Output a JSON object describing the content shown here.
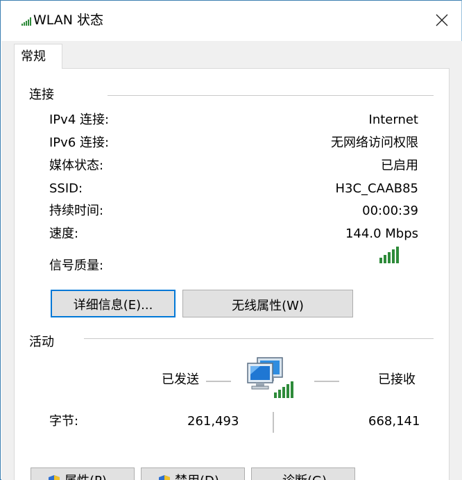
{
  "window": {
    "title": "WLAN 状态",
    "close_glyph": "✕"
  },
  "tabs": [
    {
      "label": "常规"
    }
  ],
  "connection": {
    "heading": "连接",
    "rows": [
      {
        "label": "IPv4 连接:",
        "value": "Internet"
      },
      {
        "label": "IPv6 连接:",
        "value": "无网络访问权限"
      },
      {
        "label": "媒体状态:",
        "value": "已启用"
      },
      {
        "label": "SSID:",
        "value": "H3C_CAAB85"
      },
      {
        "label": "持续时间:",
        "value": "00:00:39"
      },
      {
        "label": "速度:",
        "value": "144.0 Mbps"
      }
    ],
    "signal_label": "信号质量:",
    "signal_bars": 5,
    "signal_color": "#2e8b3a"
  },
  "buttons": {
    "details": "详细信息(E)...",
    "wireless": "无线属性(W)"
  },
  "activity": {
    "heading": "活动",
    "sent_label": "已发送",
    "received_label": "已接收",
    "bytes_label": "字节:",
    "bytes_sent": "261,493",
    "bytes_received": "668,141"
  },
  "bottom_buttons": {
    "properties": "属性(P)",
    "disable": "禁用(D)",
    "diagnose": "诊断(G)"
  },
  "colors": {
    "accent": "#0078d7",
    "button_bg": "#e1e1e1",
    "border": "#adadad"
  }
}
